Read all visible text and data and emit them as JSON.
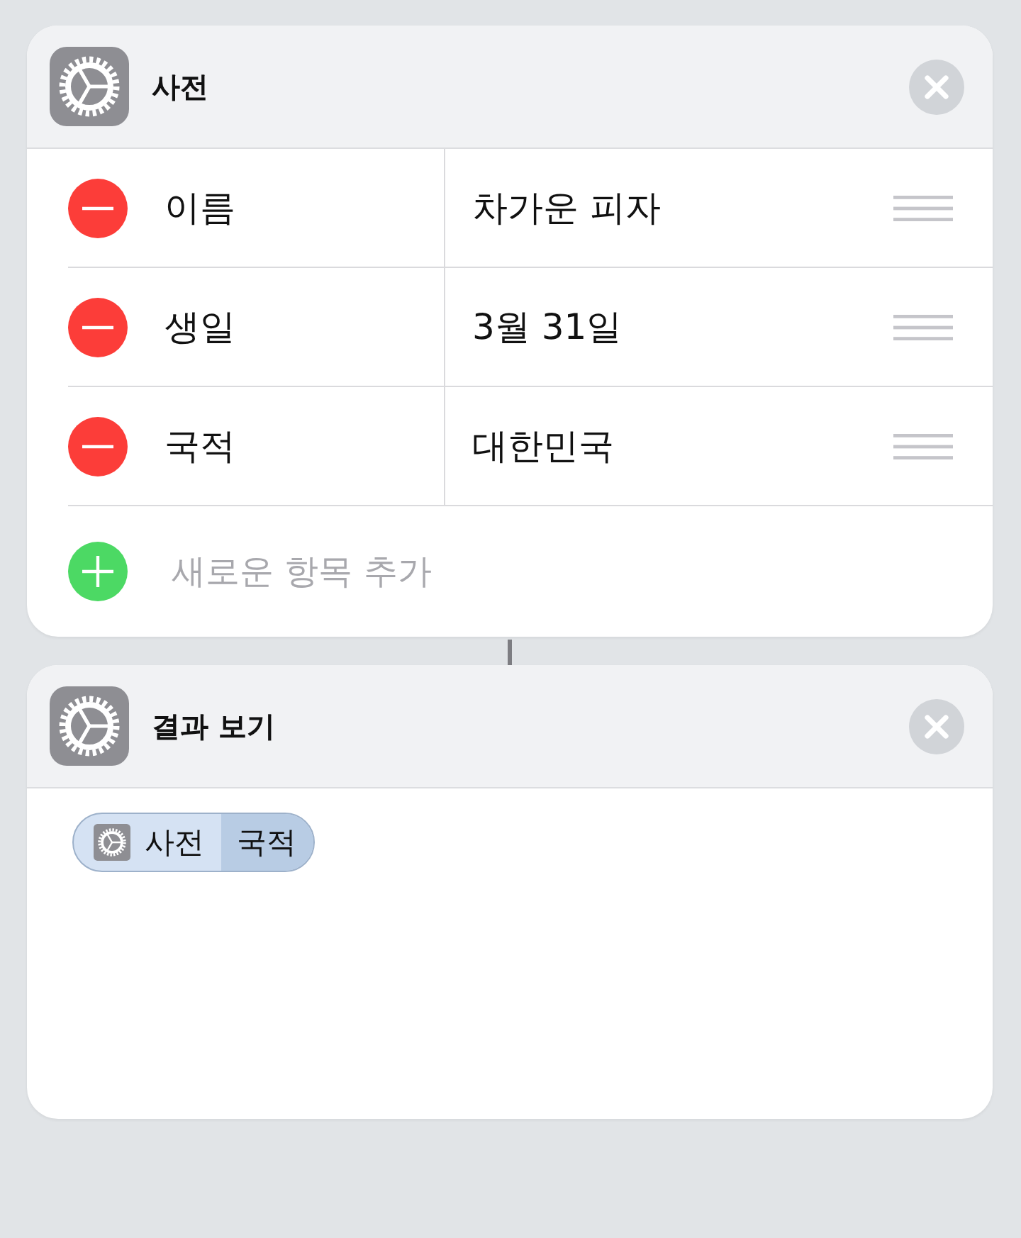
{
  "actions": [
    {
      "kind": "dictionary",
      "title": "사전",
      "entries": [
        {
          "key": "이름",
          "value": "차가운 피자"
        },
        {
          "key": "생일",
          "value": "3월 31일"
        },
        {
          "key": "국적",
          "value": "대한민국"
        }
      ],
      "add_label": "새로운 항목 추가"
    },
    {
      "kind": "output",
      "title": "결과 보기",
      "token": {
        "source": "사전",
        "key": "국적"
      }
    }
  ]
}
